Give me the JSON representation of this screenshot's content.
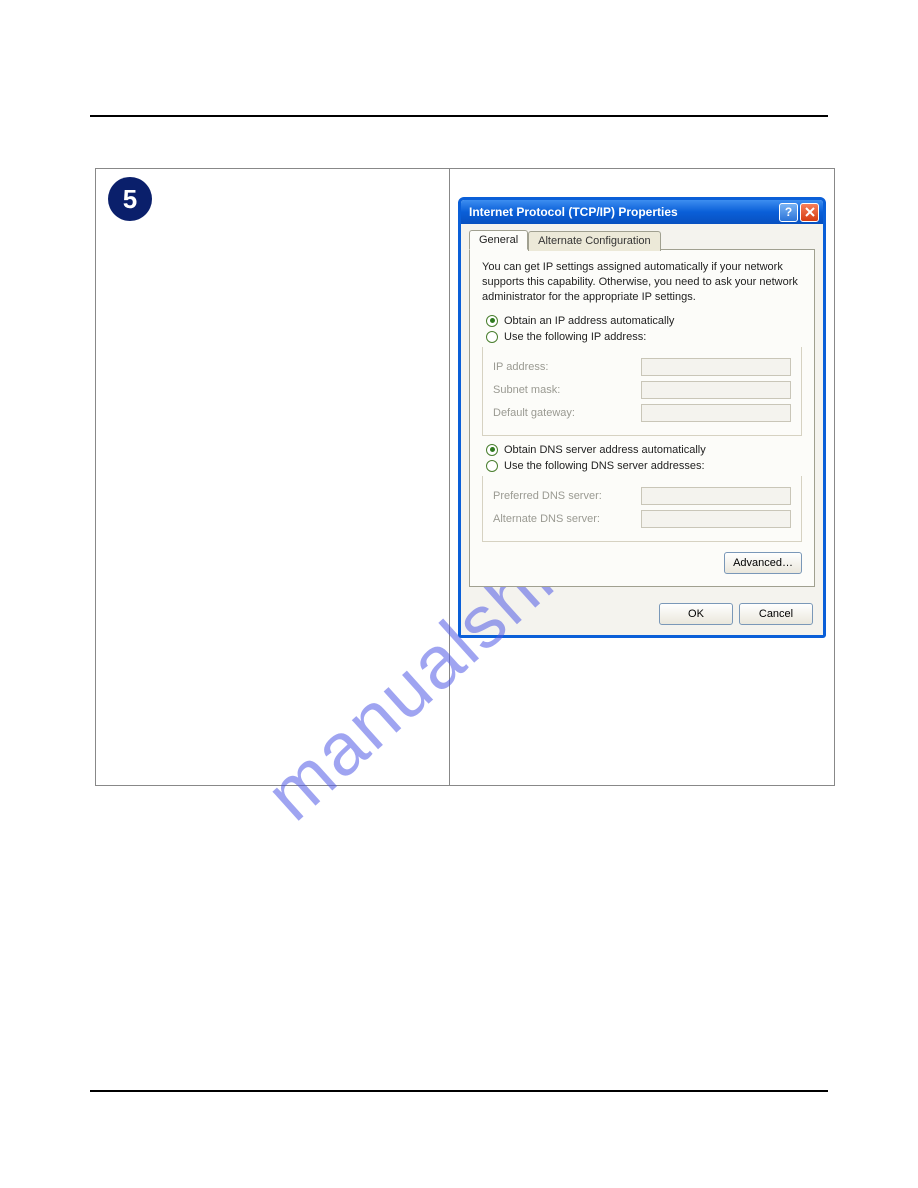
{
  "step": {
    "number": "5"
  },
  "dialog": {
    "title": "Internet Protocol (TCP/IP) Properties",
    "tabs": {
      "general": "General",
      "alternate": "Alternate Configuration"
    },
    "intro": "You can get IP settings assigned automatically if your network supports this capability. Otherwise, you need to ask your network administrator for the appropriate IP settings.",
    "ip": {
      "auto_label": "Obtain an IP address automatically",
      "manual_label": "Use the following IP address:",
      "fields": {
        "ip_address": "IP address:",
        "subnet_mask": "Subnet mask:",
        "default_gateway": "Default gateway:"
      }
    },
    "dns": {
      "auto_label": "Obtain DNS server address automatically",
      "manual_label": "Use the following DNS server addresses:",
      "fields": {
        "preferred": "Preferred DNS server:",
        "alternate": "Alternate DNS server:"
      }
    },
    "buttons": {
      "advanced": "Advanced…",
      "ok": "OK",
      "cancel": "Cancel"
    }
  },
  "watermark": "manualshive.com"
}
